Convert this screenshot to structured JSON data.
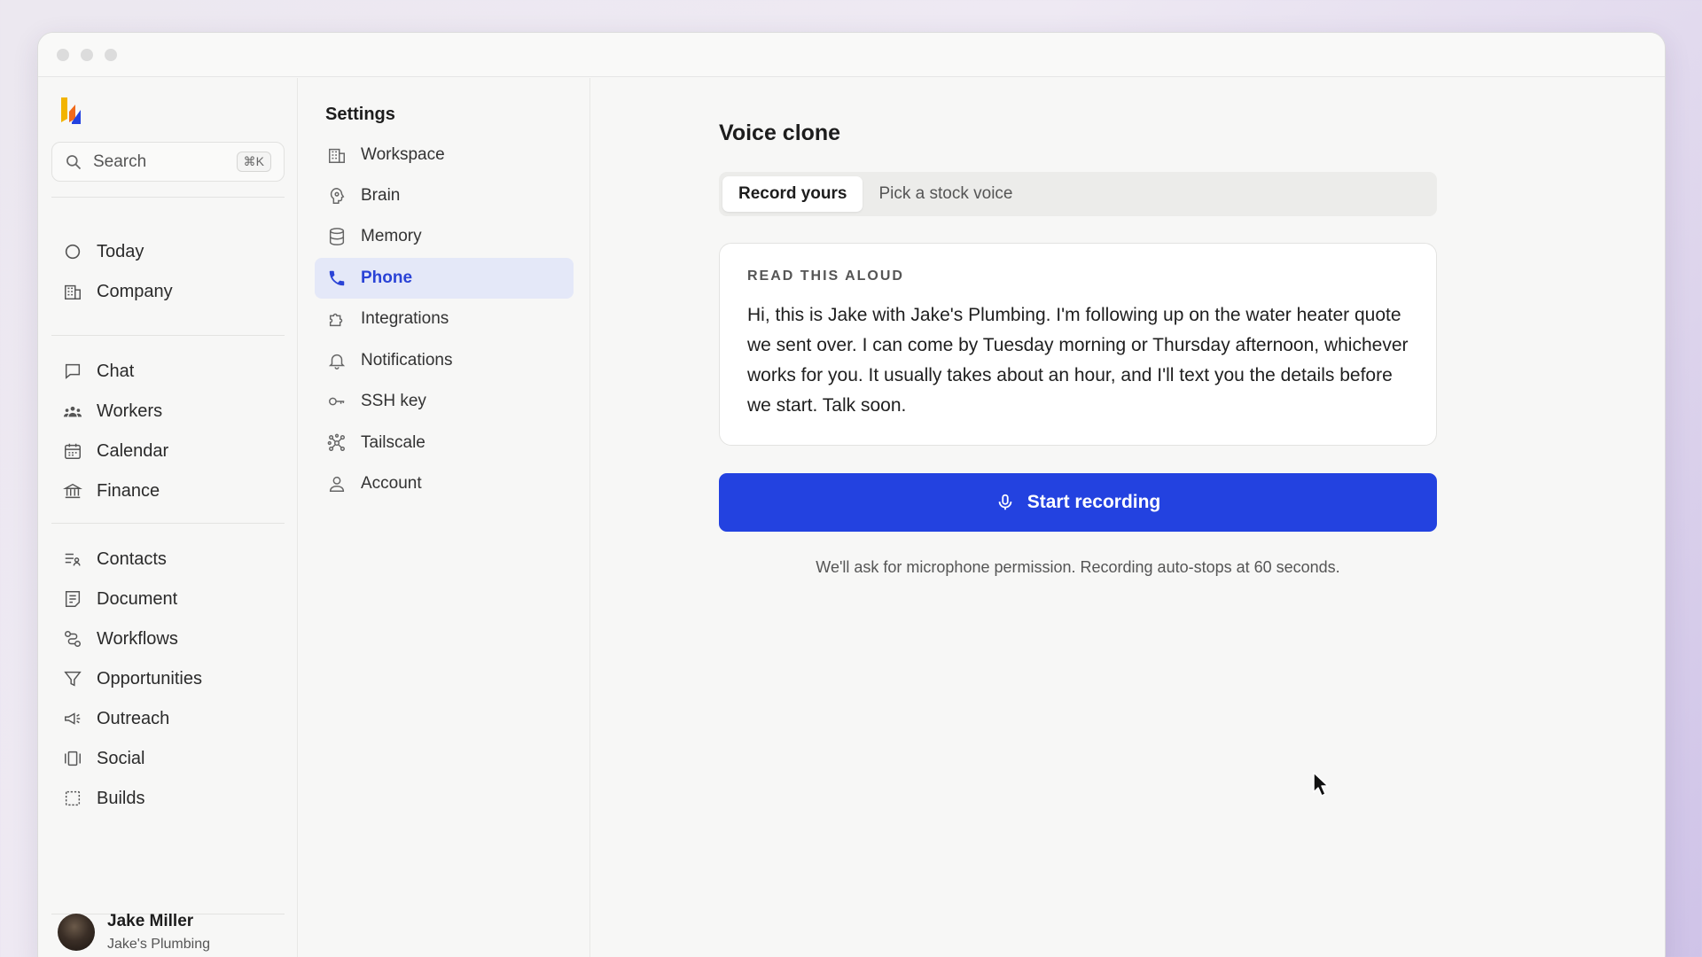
{
  "sidebar": {
    "search_label": "Search",
    "search_shortcut": "⌘K",
    "items_top": [
      {
        "label": "Today",
        "icon": "today-icon"
      },
      {
        "label": "Company",
        "icon": "building-icon"
      }
    ],
    "items_mid": [
      {
        "label": "Chat",
        "icon": "chat-icon"
      },
      {
        "label": "Workers",
        "icon": "workers-icon"
      },
      {
        "label": "Calendar",
        "icon": "calendar-icon"
      },
      {
        "label": "Finance",
        "icon": "bank-icon"
      }
    ],
    "items_bottom": [
      {
        "label": "Contacts",
        "icon": "contacts-icon"
      },
      {
        "label": "Document",
        "icon": "document-icon"
      },
      {
        "label": "Workflows",
        "icon": "workflows-icon"
      },
      {
        "label": "Opportunities",
        "icon": "funnel-icon"
      },
      {
        "label": "Outreach",
        "icon": "megaphone-icon"
      },
      {
        "label": "Social",
        "icon": "social-icon"
      },
      {
        "label": "Builds",
        "icon": "builds-icon"
      }
    ],
    "user": {
      "name": "Jake Miller",
      "org": "Jake's Plumbing"
    }
  },
  "settings": {
    "title": "Settings",
    "items": [
      {
        "label": "Workspace",
        "icon": "building-icon"
      },
      {
        "label": "Brain",
        "icon": "brain-icon"
      },
      {
        "label": "Memory",
        "icon": "database-icon"
      },
      {
        "label": "Phone",
        "icon": "phone-icon",
        "active": true
      },
      {
        "label": "Integrations",
        "icon": "puzzle-icon"
      },
      {
        "label": "Notifications",
        "icon": "bell-icon"
      },
      {
        "label": "SSH key",
        "icon": "key-icon"
      },
      {
        "label": "Tailscale",
        "icon": "network-icon"
      },
      {
        "label": "Account",
        "icon": "user-icon"
      }
    ]
  },
  "main": {
    "title": "Voice clone",
    "tabs": [
      {
        "label": "Record yours",
        "active": true
      },
      {
        "label": "Pick a stock voice",
        "active": false
      }
    ],
    "card": {
      "eyebrow": "READ THIS ALOUD",
      "script": "Hi, this is Jake with Jake's Plumbing. I'm following up on the water heater quote we sent over. I can come by Tuesday morning or Thursday afternoon, whichever works for you. It usually takes about an hour, and I'll text you the details before we start. Talk soon."
    },
    "record_button": "Start recording",
    "hint": "We'll ask for microphone permission. Recording auto-stops at 60 seconds."
  },
  "colors": {
    "accent": "#2342e0",
    "active_bg": "#e4e8f8",
    "active_text": "#2a43d6"
  }
}
